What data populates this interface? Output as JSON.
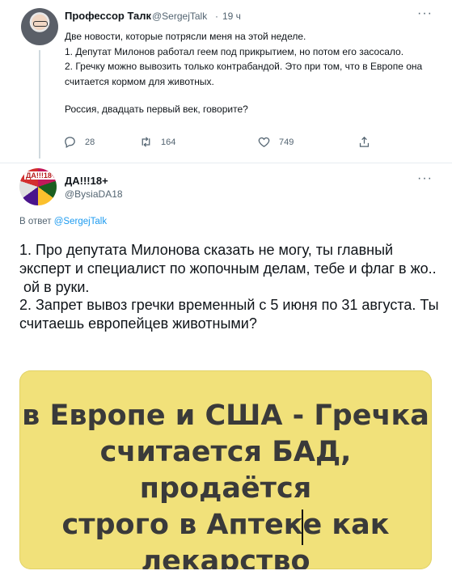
{
  "tweet1": {
    "author_name": "Профессор Талк",
    "handle": "@SergejTalk",
    "separator": "·",
    "time": "19 ч",
    "more": "···",
    "lines": [
      "Две новости, которые потрясли меня на этой неделе.",
      "1. Депутат Милонов работал геем под прикрытием, но потом его засосало.",
      "2. Гречку можно вывозить только контрабандой. Это при том, что в Европе она считается кормом для животных.",
      "Россия, двадцать первый век, говорите?"
    ],
    "actions": {
      "reply_count": "28",
      "retweet_count": "164",
      "like_count": "749"
    },
    "icons": [
      "reply-icon",
      "retweet-icon",
      "like-icon",
      "share-icon"
    ]
  },
  "tweet2": {
    "author_name": "ДА!!!18+",
    "handle": "@BysiaDA18",
    "more": "···",
    "avatar_text": "ДА!!!18+",
    "reply_prefix": "В ответ",
    "reply_handle": "@SergejTalk",
    "lines": [
      "1. Про депутата Милонова сказать не могу, ты главный  эксперт и специалист по жопочным делам, тебе и флаг в жо..",
      " ой в руки.",
      "2. Запрет вывоз гречки временный с 5 июня по 31 августа. Ты считаешь европейцев животными?"
    ],
    "media": {
      "lines": [
        "в Европе и США - Гречка",
        "считается БАД, продаётся",
        "строго в Аптеке как",
        "лекарство"
      ],
      "background": "#f1e17a"
    }
  }
}
